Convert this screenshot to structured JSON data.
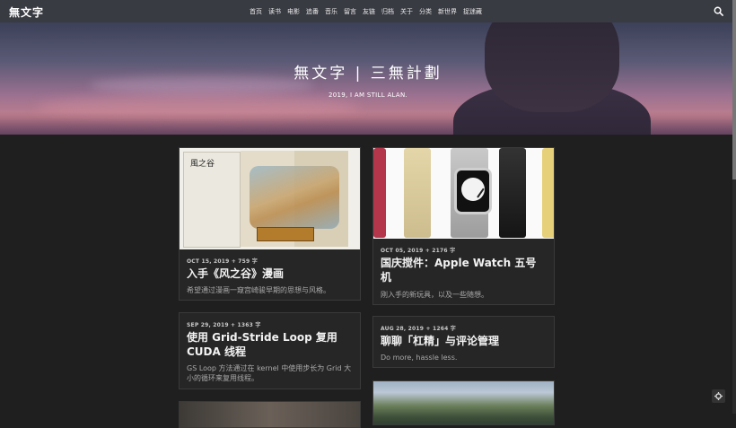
{
  "site": {
    "logo": "無文字",
    "menu": [
      "首页",
      "读书",
      "电影",
      "追番",
      "音乐",
      "留言",
      "友链",
      "归档",
      "关于",
      "分类",
      "新世界",
      "捉迷藏"
    ]
  },
  "hero": {
    "title": "無文字 | 三無計劃",
    "subtitle": "2019, I AM STILL ALAN."
  },
  "posts": [
    {
      "meta": "OCT 15, 2019 + 759 字",
      "title": "入手《风之谷》漫画",
      "excerpt": "希望通过漫画一窥宫崎骏早期的思想与风格。",
      "image_label": "風之谷"
    },
    {
      "meta": "OCT 05, 2019 + 2176 字",
      "title": "国庆搅件：Apple Watch 五号机",
      "excerpt": "刚入手的新玩具，以及一些随想。"
    },
    {
      "meta": "SEP 29, 2019 + 1363 字",
      "title": "使用 Grid-Stride Loop 复用 CUDA 线程",
      "excerpt": "GS Loop 方法通过在 kernel 中使用步长为 Grid 大小的循环来复用线程。"
    },
    {
      "meta": "AUG 28, 2019 + 1264 字",
      "title": "聊聊「杠精」与评论管理",
      "excerpt": "Do more, hassle less."
    }
  ],
  "colors": {
    "page_bg": "#1f1f1f",
    "card_bg": "#262626",
    "nav_bg": "#3c3e46"
  }
}
